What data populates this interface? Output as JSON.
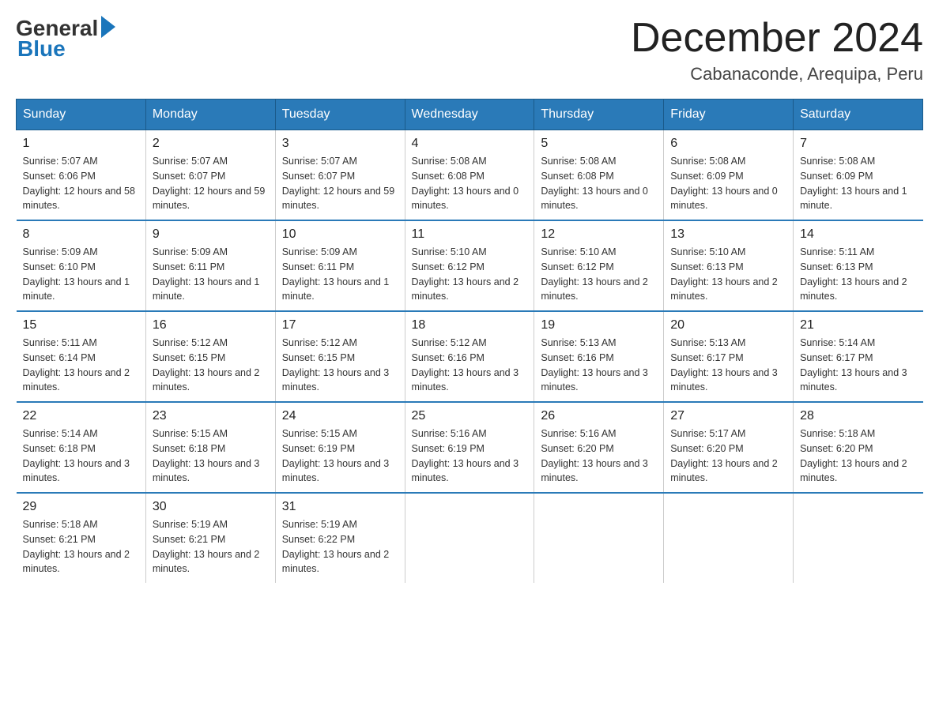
{
  "logo": {
    "general": "General",
    "blue": "Blue"
  },
  "title": "December 2024",
  "location": "Cabanaconde, Arequipa, Peru",
  "days_of_week": [
    "Sunday",
    "Monday",
    "Tuesday",
    "Wednesday",
    "Thursday",
    "Friday",
    "Saturday"
  ],
  "weeks": [
    [
      {
        "num": "1",
        "sunrise": "5:07 AM",
        "sunset": "6:06 PM",
        "daylight": "12 hours and 58 minutes."
      },
      {
        "num": "2",
        "sunrise": "5:07 AM",
        "sunset": "6:07 PM",
        "daylight": "12 hours and 59 minutes."
      },
      {
        "num": "3",
        "sunrise": "5:07 AM",
        "sunset": "6:07 PM",
        "daylight": "12 hours and 59 minutes."
      },
      {
        "num": "4",
        "sunrise": "5:08 AM",
        "sunset": "6:08 PM",
        "daylight": "13 hours and 0 minutes."
      },
      {
        "num": "5",
        "sunrise": "5:08 AM",
        "sunset": "6:08 PM",
        "daylight": "13 hours and 0 minutes."
      },
      {
        "num": "6",
        "sunrise": "5:08 AM",
        "sunset": "6:09 PM",
        "daylight": "13 hours and 0 minutes."
      },
      {
        "num": "7",
        "sunrise": "5:08 AM",
        "sunset": "6:09 PM",
        "daylight": "13 hours and 1 minute."
      }
    ],
    [
      {
        "num": "8",
        "sunrise": "5:09 AM",
        "sunset": "6:10 PM",
        "daylight": "13 hours and 1 minute."
      },
      {
        "num": "9",
        "sunrise": "5:09 AM",
        "sunset": "6:11 PM",
        "daylight": "13 hours and 1 minute."
      },
      {
        "num": "10",
        "sunrise": "5:09 AM",
        "sunset": "6:11 PM",
        "daylight": "13 hours and 1 minute."
      },
      {
        "num": "11",
        "sunrise": "5:10 AM",
        "sunset": "6:12 PM",
        "daylight": "13 hours and 2 minutes."
      },
      {
        "num": "12",
        "sunrise": "5:10 AM",
        "sunset": "6:12 PM",
        "daylight": "13 hours and 2 minutes."
      },
      {
        "num": "13",
        "sunrise": "5:10 AM",
        "sunset": "6:13 PM",
        "daylight": "13 hours and 2 minutes."
      },
      {
        "num": "14",
        "sunrise": "5:11 AM",
        "sunset": "6:13 PM",
        "daylight": "13 hours and 2 minutes."
      }
    ],
    [
      {
        "num": "15",
        "sunrise": "5:11 AM",
        "sunset": "6:14 PM",
        "daylight": "13 hours and 2 minutes."
      },
      {
        "num": "16",
        "sunrise": "5:12 AM",
        "sunset": "6:15 PM",
        "daylight": "13 hours and 2 minutes."
      },
      {
        "num": "17",
        "sunrise": "5:12 AM",
        "sunset": "6:15 PM",
        "daylight": "13 hours and 3 minutes."
      },
      {
        "num": "18",
        "sunrise": "5:12 AM",
        "sunset": "6:16 PM",
        "daylight": "13 hours and 3 minutes."
      },
      {
        "num": "19",
        "sunrise": "5:13 AM",
        "sunset": "6:16 PM",
        "daylight": "13 hours and 3 minutes."
      },
      {
        "num": "20",
        "sunrise": "5:13 AM",
        "sunset": "6:17 PM",
        "daylight": "13 hours and 3 minutes."
      },
      {
        "num": "21",
        "sunrise": "5:14 AM",
        "sunset": "6:17 PM",
        "daylight": "13 hours and 3 minutes."
      }
    ],
    [
      {
        "num": "22",
        "sunrise": "5:14 AM",
        "sunset": "6:18 PM",
        "daylight": "13 hours and 3 minutes."
      },
      {
        "num": "23",
        "sunrise": "5:15 AM",
        "sunset": "6:18 PM",
        "daylight": "13 hours and 3 minutes."
      },
      {
        "num": "24",
        "sunrise": "5:15 AM",
        "sunset": "6:19 PM",
        "daylight": "13 hours and 3 minutes."
      },
      {
        "num": "25",
        "sunrise": "5:16 AM",
        "sunset": "6:19 PM",
        "daylight": "13 hours and 3 minutes."
      },
      {
        "num": "26",
        "sunrise": "5:16 AM",
        "sunset": "6:20 PM",
        "daylight": "13 hours and 3 minutes."
      },
      {
        "num": "27",
        "sunrise": "5:17 AM",
        "sunset": "6:20 PM",
        "daylight": "13 hours and 2 minutes."
      },
      {
        "num": "28",
        "sunrise": "5:18 AM",
        "sunset": "6:20 PM",
        "daylight": "13 hours and 2 minutes."
      }
    ],
    [
      {
        "num": "29",
        "sunrise": "5:18 AM",
        "sunset": "6:21 PM",
        "daylight": "13 hours and 2 minutes."
      },
      {
        "num": "30",
        "sunrise": "5:19 AM",
        "sunset": "6:21 PM",
        "daylight": "13 hours and 2 minutes."
      },
      {
        "num": "31",
        "sunrise": "5:19 AM",
        "sunset": "6:22 PM",
        "daylight": "13 hours and 2 minutes."
      },
      null,
      null,
      null,
      null
    ]
  ]
}
